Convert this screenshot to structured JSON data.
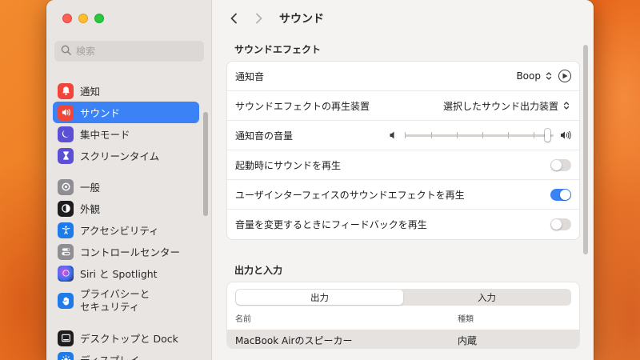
{
  "search": {
    "placeholder": "検索"
  },
  "sidebar": {
    "items": [
      {
        "label": "通知",
        "icon": "bell-icon",
        "color": "#f0453a"
      },
      {
        "label": "サウンド",
        "icon": "speaker-icon",
        "color": "#f0453a",
        "selected": true
      },
      {
        "label": "集中モード",
        "icon": "moon-icon",
        "color": "#5b4fd6"
      },
      {
        "label": "スクリーンタイム",
        "icon": "hourglass-icon",
        "color": "#5b4fd6"
      },
      {
        "label": "一般",
        "icon": "gear-icon",
        "color": "#8e8e93"
      },
      {
        "label": "外観",
        "icon": "appearance-icon",
        "color": "#1d1d1f"
      },
      {
        "label": "アクセシビリティ",
        "icon": "accessibility-icon",
        "color": "#1f7bea"
      },
      {
        "label": "コントロールセンター",
        "icon": "control-center-icon",
        "color": "#8e8e93"
      },
      {
        "label": "Siri と Spotlight",
        "icon": "siri-icon",
        "color": "#7a3fd1"
      },
      {
        "label_line1": "プライバシーと",
        "label_line2": "セキュリティ",
        "icon": "hand-icon",
        "color": "#1f7bea"
      },
      {
        "label": "デスクトップと Dock",
        "icon": "dock-icon",
        "color": "#1d1d1f"
      },
      {
        "label": "ディスプレイ",
        "icon": "display-icon",
        "color": "#1f7bea"
      }
    ]
  },
  "toolbar": {
    "title": "サウンド"
  },
  "sound_effects": {
    "section_title": "サウンドエフェクト",
    "alert_sound_label": "通知音",
    "alert_sound_value": "Boop",
    "output_device_label": "サウンドエフェクトの再生装置",
    "output_device_value": "選択したサウンド出力装置",
    "alert_volume_label": "通知音の音量",
    "alert_volume_level": 0.98,
    "startup_sound_label": "起動時にサウンドを再生",
    "startup_sound_on": false,
    "ui_sound_label": "ユーザインターフェイスのサウンドエフェクトを再生",
    "ui_sound_on": true,
    "feedback_label": "音量を変更するときにフィードバックを再生",
    "feedback_on": false
  },
  "io": {
    "section_title": "出力と入力",
    "tab_output": "出力",
    "tab_input": "入力",
    "active_tab": "output",
    "col_name": "名前",
    "col_type": "種類",
    "rows": [
      {
        "name": "MacBook Airのスピーカー",
        "type": "内蔵"
      }
    ]
  },
  "colors": {
    "accent": "#3b82f6",
    "sound_icon": "#f0453a"
  }
}
